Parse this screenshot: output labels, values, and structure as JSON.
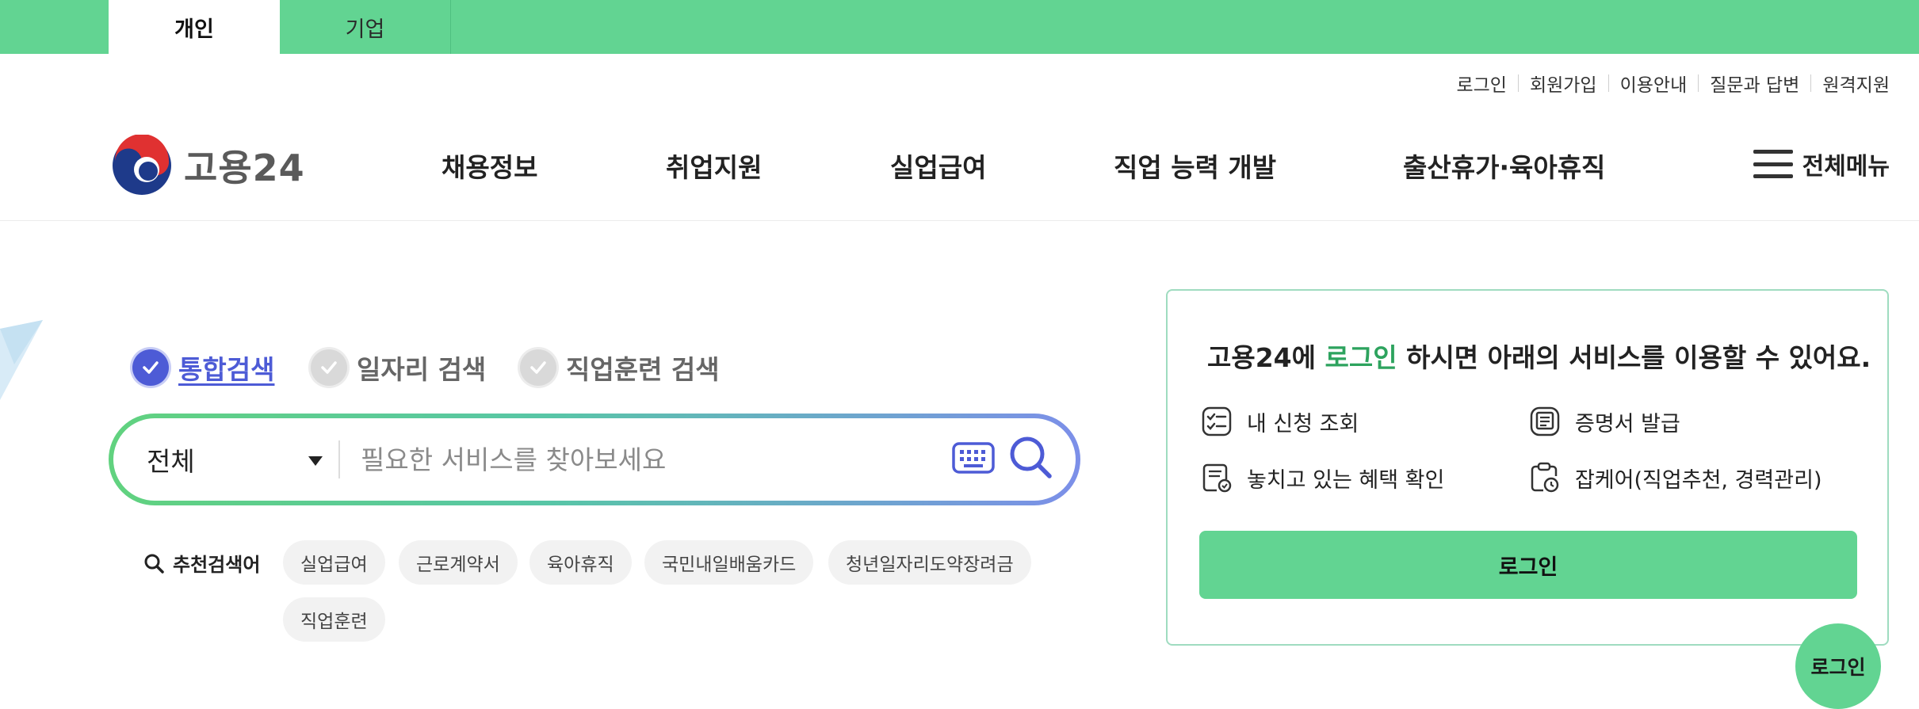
{
  "top_tabs": [
    {
      "label": "개인",
      "active": true
    },
    {
      "label": "기업",
      "active": false
    }
  ],
  "utility_links": [
    "로그인",
    "회원가입",
    "이용안내",
    "질문과 답변",
    "원격지원"
  ],
  "logo": {
    "text": "고용24",
    "icon": "taegeuk-logo-icon"
  },
  "gnb": [
    "채용정보",
    "취업지원",
    "실업급여",
    "직업 능력 개발",
    "출산휴가·육아휴직"
  ],
  "all_menu": {
    "label": "전체메뉴",
    "icon": "hamburger-icon"
  },
  "search": {
    "types": [
      {
        "label": "통합검색",
        "selected": true
      },
      {
        "label": "일자리 검색",
        "selected": false
      },
      {
        "label": "직업훈련 검색",
        "selected": false
      }
    ],
    "category": "전체",
    "placeholder": "필요한 서비스를 찾아보세요",
    "keyboard_icon": "keyboard-icon",
    "search_icon": "search-icon"
  },
  "recommended": {
    "title": "추천검색어",
    "keywords": [
      "실업급여",
      "근로계약서",
      "육아휴직",
      "국민내일배움카드",
      "청년일자리도약장려금",
      "직업훈련"
    ]
  },
  "login_panel": {
    "title_prefix": "고용24에 ",
    "title_highlight": "로그인",
    "title_suffix": " 하시면 아래의 서비스를 이용할 수 있어요.",
    "services": [
      {
        "label": "내 신청 조회",
        "icon": "checklist-icon"
      },
      {
        "label": "증명서 발급",
        "icon": "certificate-icon"
      },
      {
        "label": "놓치고 있는 혜택 확인",
        "icon": "benefit-document-icon"
      },
      {
        "label": "잡케어(직업추천, 경력관리)",
        "icon": "clipboard-clock-icon"
      }
    ],
    "button_label": "로그인"
  },
  "fab_label": "로그인",
  "colors": {
    "brand_green": "#62d492",
    "accent_blue": "#4d5bd6",
    "highlight_green": "#2da35e"
  }
}
